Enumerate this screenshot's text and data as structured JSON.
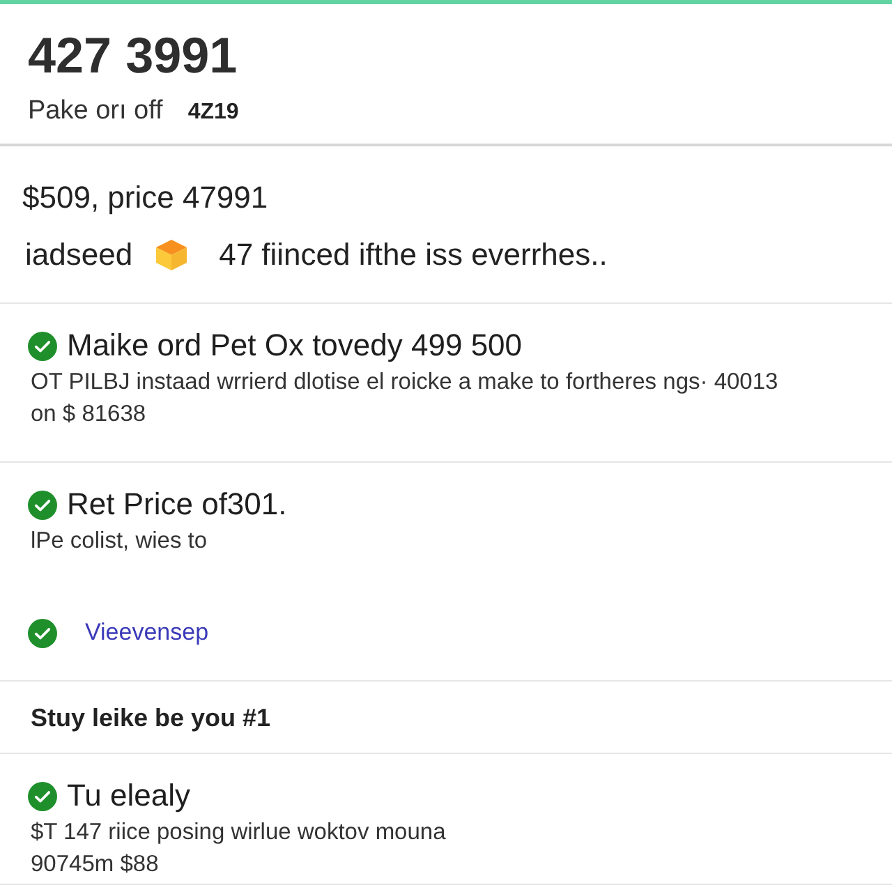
{
  "header": {
    "title": "427 3991",
    "subtitle": "Pake orı off",
    "code": "4Z19"
  },
  "summary": {
    "price_line": "$509, price 47991",
    "note_label": "iadseed",
    "note_text": "47 fiinced ifthe iss everrhes.."
  },
  "sections": [
    {
      "kind": "item",
      "title": "Maike ord Pet Ox tovedy 499 500",
      "lines": [
        "OT PILBJ instaad wrrierd dlotise el roicke a make to fortheres ngs· 40013",
        "on $ 81638"
      ]
    },
    {
      "kind": "item",
      "title": "Ret Price of301.",
      "lines": [
        "lPe colist, wies to"
      ],
      "link": "Vieevensep"
    },
    {
      "kind": "heading",
      "title": "Stuy leike be you #1"
    },
    {
      "kind": "item",
      "title": "Tu elealy",
      "lines": [
        "$T 147 riice posing wirlue woktov mouna",
        "90745m $88"
      ]
    }
  ]
}
